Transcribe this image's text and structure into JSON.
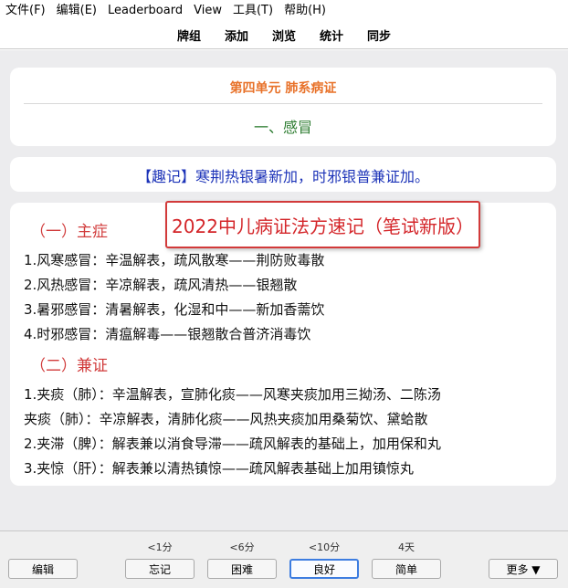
{
  "menu": [
    "文件(F)",
    "编辑(E)",
    "Leaderboard",
    "View",
    "工具(T)",
    "帮助(H)"
  ],
  "toolbar": [
    "牌组",
    "添加",
    "浏览",
    "统计",
    "同步"
  ],
  "card": {
    "unit_title": "第四单元 肺系病证",
    "topic": "一、感冒",
    "mnemonic": "【趣记】寒荆热银暑新加，时邪银普兼证加。",
    "section1_heading": "（一）主症",
    "section1_lines": [
      "1.风寒感冒：辛温解表，疏风散寒——荆防败毒散",
      "2.风热感冒：辛凉解表，疏风清热——银翘散",
      "3.暑邪感冒：清暑解表，化湿和中——新加香薷饮",
      "4.时邪感冒：清瘟解毒——银翘散合普济消毒饮"
    ],
    "section2_heading": "（二）兼证",
    "section2_lines": [
      "1.夹痰（肺）：辛温解表，宣肺化痰——风寒夹痰加用三拗汤、二陈汤",
      "夹痰（肺）：辛凉解表，清肺化痰——风热夹痰加用桑菊饮、黛蛤散",
      "2.夹滞（脾）：解表兼以消食导滞——疏风解表的基础上，加用保和丸",
      "3.夹惊（肝）：解表兼以清热镇惊——疏风解表基础上加用镇惊丸"
    ]
  },
  "overlay": "2022中儿病证法方速记（笔试新版）",
  "bottom": {
    "edit_label": "编辑",
    "more_label": "更多 ▼",
    "hints": [
      "<1分",
      "<6分",
      "<10分",
      "4天"
    ],
    "answers": [
      "忘记",
      "困难",
      "良好",
      "简单"
    ]
  },
  "colors": {
    "unit_title": "#e8722a",
    "topic": "#2e7d32",
    "mnemonic": "#1c33b8",
    "heading": "#d13b3b",
    "overlay_border": "#d23a3a",
    "focus": "#3d7de0"
  }
}
